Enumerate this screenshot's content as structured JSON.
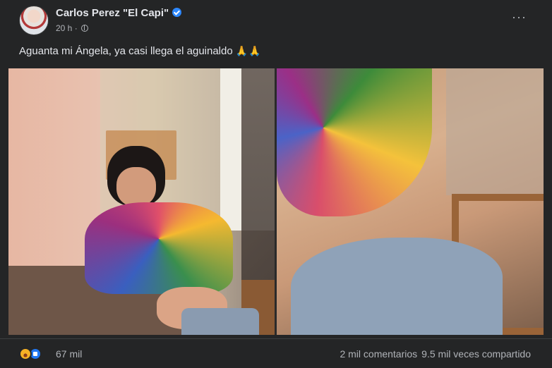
{
  "post": {
    "author": "Carlos Perez \"El Capi\"",
    "verified": true,
    "time": "20 h",
    "separator": "·",
    "audience_icon": "globe-icon",
    "more_label": "···",
    "caption": "Aguanta mi Ángela, ya casi llega el aguinaldo",
    "caption_emoji": "🙏🙏"
  },
  "media": {
    "images": 2
  },
  "footer": {
    "reaction_icons": [
      "haha-reaction-icon",
      "like-reaction-icon"
    ],
    "reaction_count": "67 mil",
    "comments": "2 mil comentarios",
    "shares": "9.5 mil veces compartido"
  },
  "colors": {
    "background": "#242526",
    "text": "#e4e6eb",
    "secondary_text": "#b0b3b8",
    "verified": "#2d88ff",
    "like": "#2078f4",
    "haha": "#f7b125"
  }
}
